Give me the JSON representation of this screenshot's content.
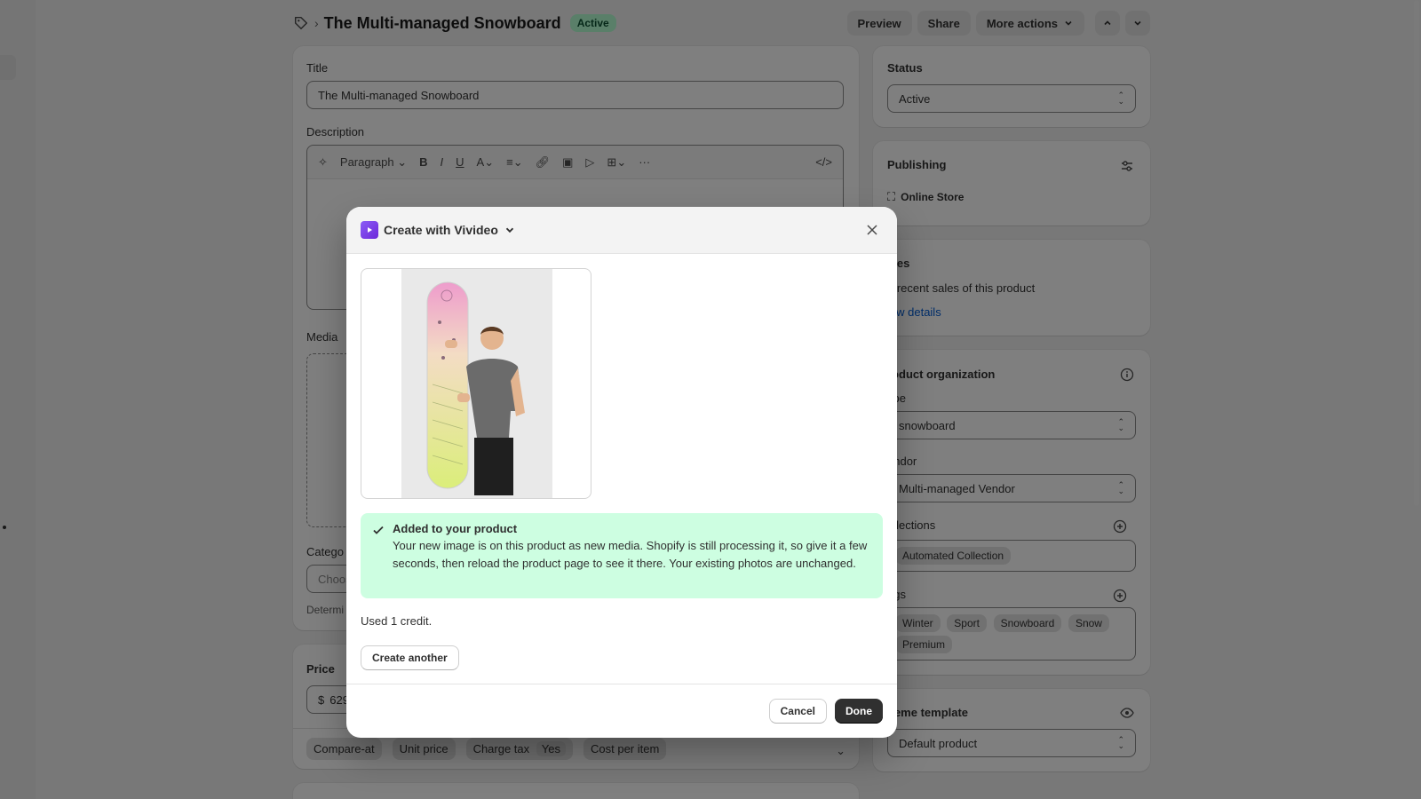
{
  "header": {
    "title": "The Multi-managed Snowboard",
    "status_badge": "Active",
    "preview_label": "Preview",
    "share_label": "Share",
    "more_actions_label": "More actions"
  },
  "main": {
    "title_label": "Title",
    "title_value": "The Multi-managed Snowboard",
    "description_label": "Description",
    "editor_paragraph": "Paragraph",
    "media_label": "Media",
    "category_label": "Catego",
    "category_placeholder": "Choos",
    "category_help": "Determi",
    "price_label": "Price",
    "price_currency": "$",
    "price_value": "629",
    "price_pills": {
      "compare_at": "Compare-at",
      "unit_price": "Unit price",
      "charge_tax": "Charge tax",
      "charge_tax_value": "Yes",
      "cost_per_item": "Cost per item"
    }
  },
  "side": {
    "status_label": "Status",
    "status_value": "Active",
    "publishing_label": "Publishing",
    "online_store": "Online Store",
    "sales_label": "ales",
    "sales_text": "o recent sales of this product",
    "sales_link": "iew details",
    "org_label": "roduct organization",
    "type_label": "ype",
    "type_value": "snowboard",
    "vendor_label": "endor",
    "vendor_value": "Multi-managed Vendor",
    "collections_label": "ollections",
    "collection_pill": "Automated Collection",
    "tags_label": "ags",
    "tags": [
      "Winter",
      "Sport",
      "Snowboard",
      "Snow",
      "Premium"
    ],
    "theme_label": "heme template",
    "theme_value": "Default product"
  },
  "modal": {
    "title": "Create with Vivideo",
    "banner_title": "Added to your product",
    "banner_text": "Your new image is on this product as new media. Shopify is still processing it, so give it a few seconds, then reload the product page to see it there. Your existing photos are unchanged.",
    "credits": "Used 1 credit.",
    "create_another": "Create another",
    "cancel": "Cancel",
    "done": "Done"
  }
}
